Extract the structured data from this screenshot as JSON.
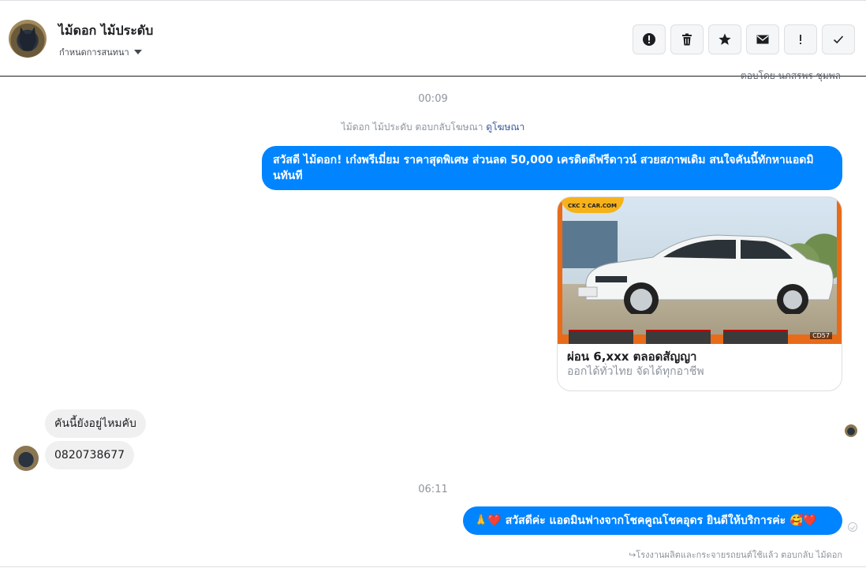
{
  "header": {
    "contact_name": "ไม้ดอก ไม้ประดับ",
    "assign_label": "กำหนดการสนทนา"
  },
  "toolbar": {
    "items": [
      {
        "name": "spam-button",
        "icon": "exclamation-circle-icon"
      },
      {
        "name": "delete-button",
        "icon": "trash-icon"
      },
      {
        "name": "star-button",
        "icon": "star-icon"
      },
      {
        "name": "unread-button",
        "icon": "envelope-icon"
      },
      {
        "name": "priority-button",
        "icon": "exclamation-icon"
      },
      {
        "name": "done-button",
        "icon": "check-icon"
      }
    ]
  },
  "messages": {
    "cut_text": "ตอบโดย นภสรพร ชุมพล ",
    "time1": "00:09",
    "ad_note_text": "ไม้ดอก ไม้ประดับ ตอบกลับโฆษณา",
    "ad_note_link": "ดูโฆษณา",
    "out1": "สวัสดี ไม้ดอก! เก๋งพรีเมี่ยม ราคาสุดพิเศษ ส่วนลด 50,000 เครดิตดีฟรีดาวน์ สวยสภาพเดิม สนใจคันนี้ทักหาแอดมินทันที",
    "card_title": "ผ่อน 6,xxx ตลอดสัญญา",
    "card_sub": "ออกได้ทั่วไทย จัดได้ทุกอาชีพ",
    "card_logo": "CKC 2 CAR.COM",
    "card_code": "CD57",
    "in1": "คันนี้ยังอยู่ไหมคับ",
    "in2": "0820738677",
    "time2": "06:11",
    "out2": "🙏❤️ สวัสดีค่ะ แอดมินฟางจากโชคคูณโชคอุดร ยินดีให้บริการค่ะ 🥰❤️",
    "footer_note": "↪โรงงานผลิตและกระจายรถยนต์ใช้แล้ว ตอบกลับ ไม้ดอก"
  }
}
